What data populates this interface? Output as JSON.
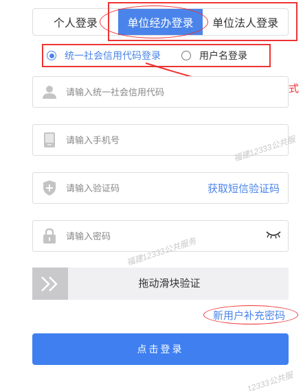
{
  "tabs": [
    {
      "label": "个人登录"
    },
    {
      "label": "单位经办登录",
      "active": true
    },
    {
      "label": "单位法人登录"
    }
  ],
  "login_method": {
    "options": [
      {
        "label": "统一社会信用代码登录",
        "checked": true
      },
      {
        "label": "用户名登录",
        "checked": false
      }
    ]
  },
  "annotation": {
    "text": "可选择登录方式"
  },
  "fields": {
    "credit_code": {
      "placeholder": "请输入统一社会信用代码",
      "icon": "user-icon"
    },
    "phone": {
      "placeholder": "请输入手机号",
      "icon": "phone-icon"
    },
    "sms_code": {
      "placeholder": "请输入验证码",
      "icon": "shield-icon",
      "link": "获取短信验证码"
    },
    "password": {
      "placeholder": "请输入密码",
      "icon": "lock-icon",
      "toggle_icon": "eye-closed-icon"
    }
  },
  "slider": {
    "label": "拖动滑块验证",
    "icon": "double-chevron-right-icon"
  },
  "links": {
    "new_user": "新用户补充密码"
  },
  "login_button": {
    "label": "点击登录"
  },
  "watermarks": [
    "福建12333公共服",
    "福建12333公共服务",
    "12333公共服"
  ],
  "colors": {
    "primary": "#4a84ea",
    "annotation": "#e33333"
  }
}
